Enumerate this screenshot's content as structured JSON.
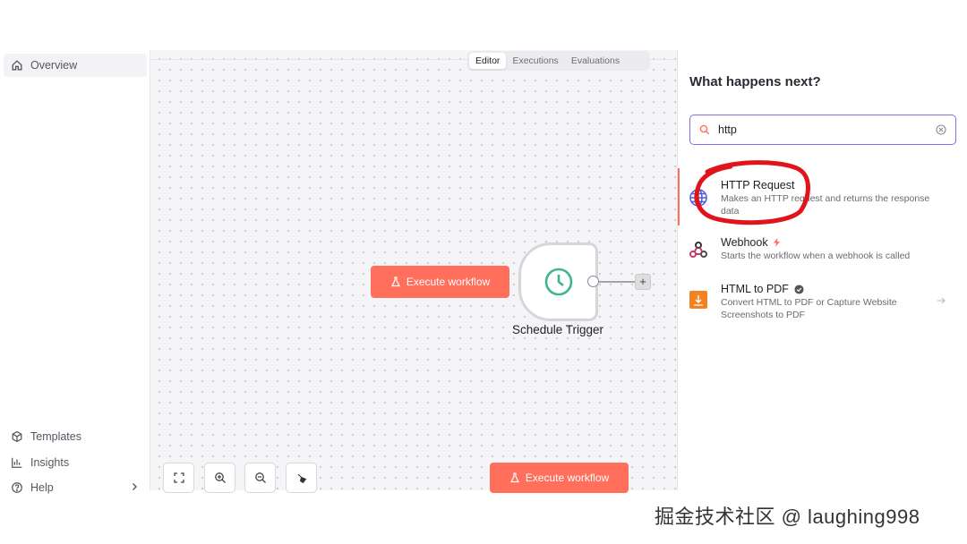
{
  "sidebar": {
    "items": [
      {
        "label": "Overview",
        "icon": "home-icon"
      },
      {
        "label": "Templates",
        "icon": "box-icon"
      },
      {
        "label": "Insights",
        "icon": "bar-chart-icon"
      },
      {
        "label": "Help",
        "icon": "help-icon"
      }
    ]
  },
  "canvas": {
    "tabs": [
      {
        "label": "Editor",
        "active": true
      },
      {
        "label": "Executions",
        "active": false
      },
      {
        "label": "Evaluations",
        "active": false
      }
    ],
    "execute_label": "Execute workflow",
    "execute_label_bottom": "Execute workflow",
    "node": {
      "label": "Schedule Trigger",
      "icon": "clock-icon",
      "color": "#3fb58e"
    },
    "accent": "#ff6f5c"
  },
  "panel": {
    "title": "What happens next?",
    "search": {
      "value": "http",
      "placeholder": ""
    },
    "results": [
      {
        "title": "HTTP Request",
        "desc": "Makes an HTTP request and returns the response data",
        "icon": "globe-icon"
      },
      {
        "title": "Webhook",
        "desc": "Starts the workflow when a webhook is called",
        "icon": "webhook-icon"
      },
      {
        "title": "HTML to PDF",
        "desc": "Convert HTML to PDF or Capture Website Screenshots to PDF",
        "icon": "pdf-icon"
      }
    ]
  },
  "watermark": "掘金技术社区 @ laughing998"
}
